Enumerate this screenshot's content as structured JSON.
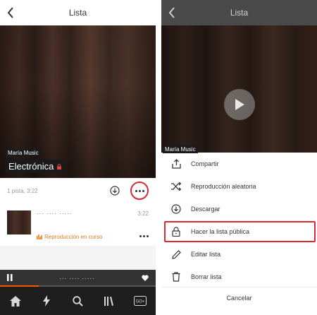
{
  "left_screen": {
    "header": {
      "title": "Lista"
    },
    "artwork": {
      "owner": "María Music",
      "playlist_name": "Electrónica"
    },
    "meta": {
      "track_count": "1 pista, 3:22"
    },
    "track": {
      "title": "··· ···· ·····",
      "duration": "3:22",
      "status": "Reproducción en curso"
    },
    "mini_player": {
      "now_playing": "··· ···· ·····",
      "progress": 0.25
    },
    "tabbar": {
      "items": [
        "home-icon",
        "stream-icon",
        "search-icon",
        "library-icon",
        "go-icon"
      ],
      "go_label": "GO+"
    }
  },
  "right_screen": {
    "header": {
      "title": "Lista"
    },
    "artwork": {
      "owner": "María Music"
    },
    "menu": {
      "items": [
        {
          "label": "Compartir",
          "icon": "share-icon"
        },
        {
          "label": "Reproducción aleatoria",
          "icon": "shuffle-icon"
        },
        {
          "label": "Descargar",
          "icon": "download-icon"
        },
        {
          "label": "Hacer la lista pública",
          "icon": "lock-icon"
        },
        {
          "label": "Editar lista",
          "icon": "pencil-icon"
        },
        {
          "label": "Borrar lista",
          "icon": "trash-icon"
        }
      ],
      "cancel": "Cancelar",
      "highlighted_item": "Hacer la lista pública"
    }
  },
  "colors": {
    "accent": "#ff5500",
    "highlight": "#d62b35",
    "now_playing": "#e07a1f"
  }
}
